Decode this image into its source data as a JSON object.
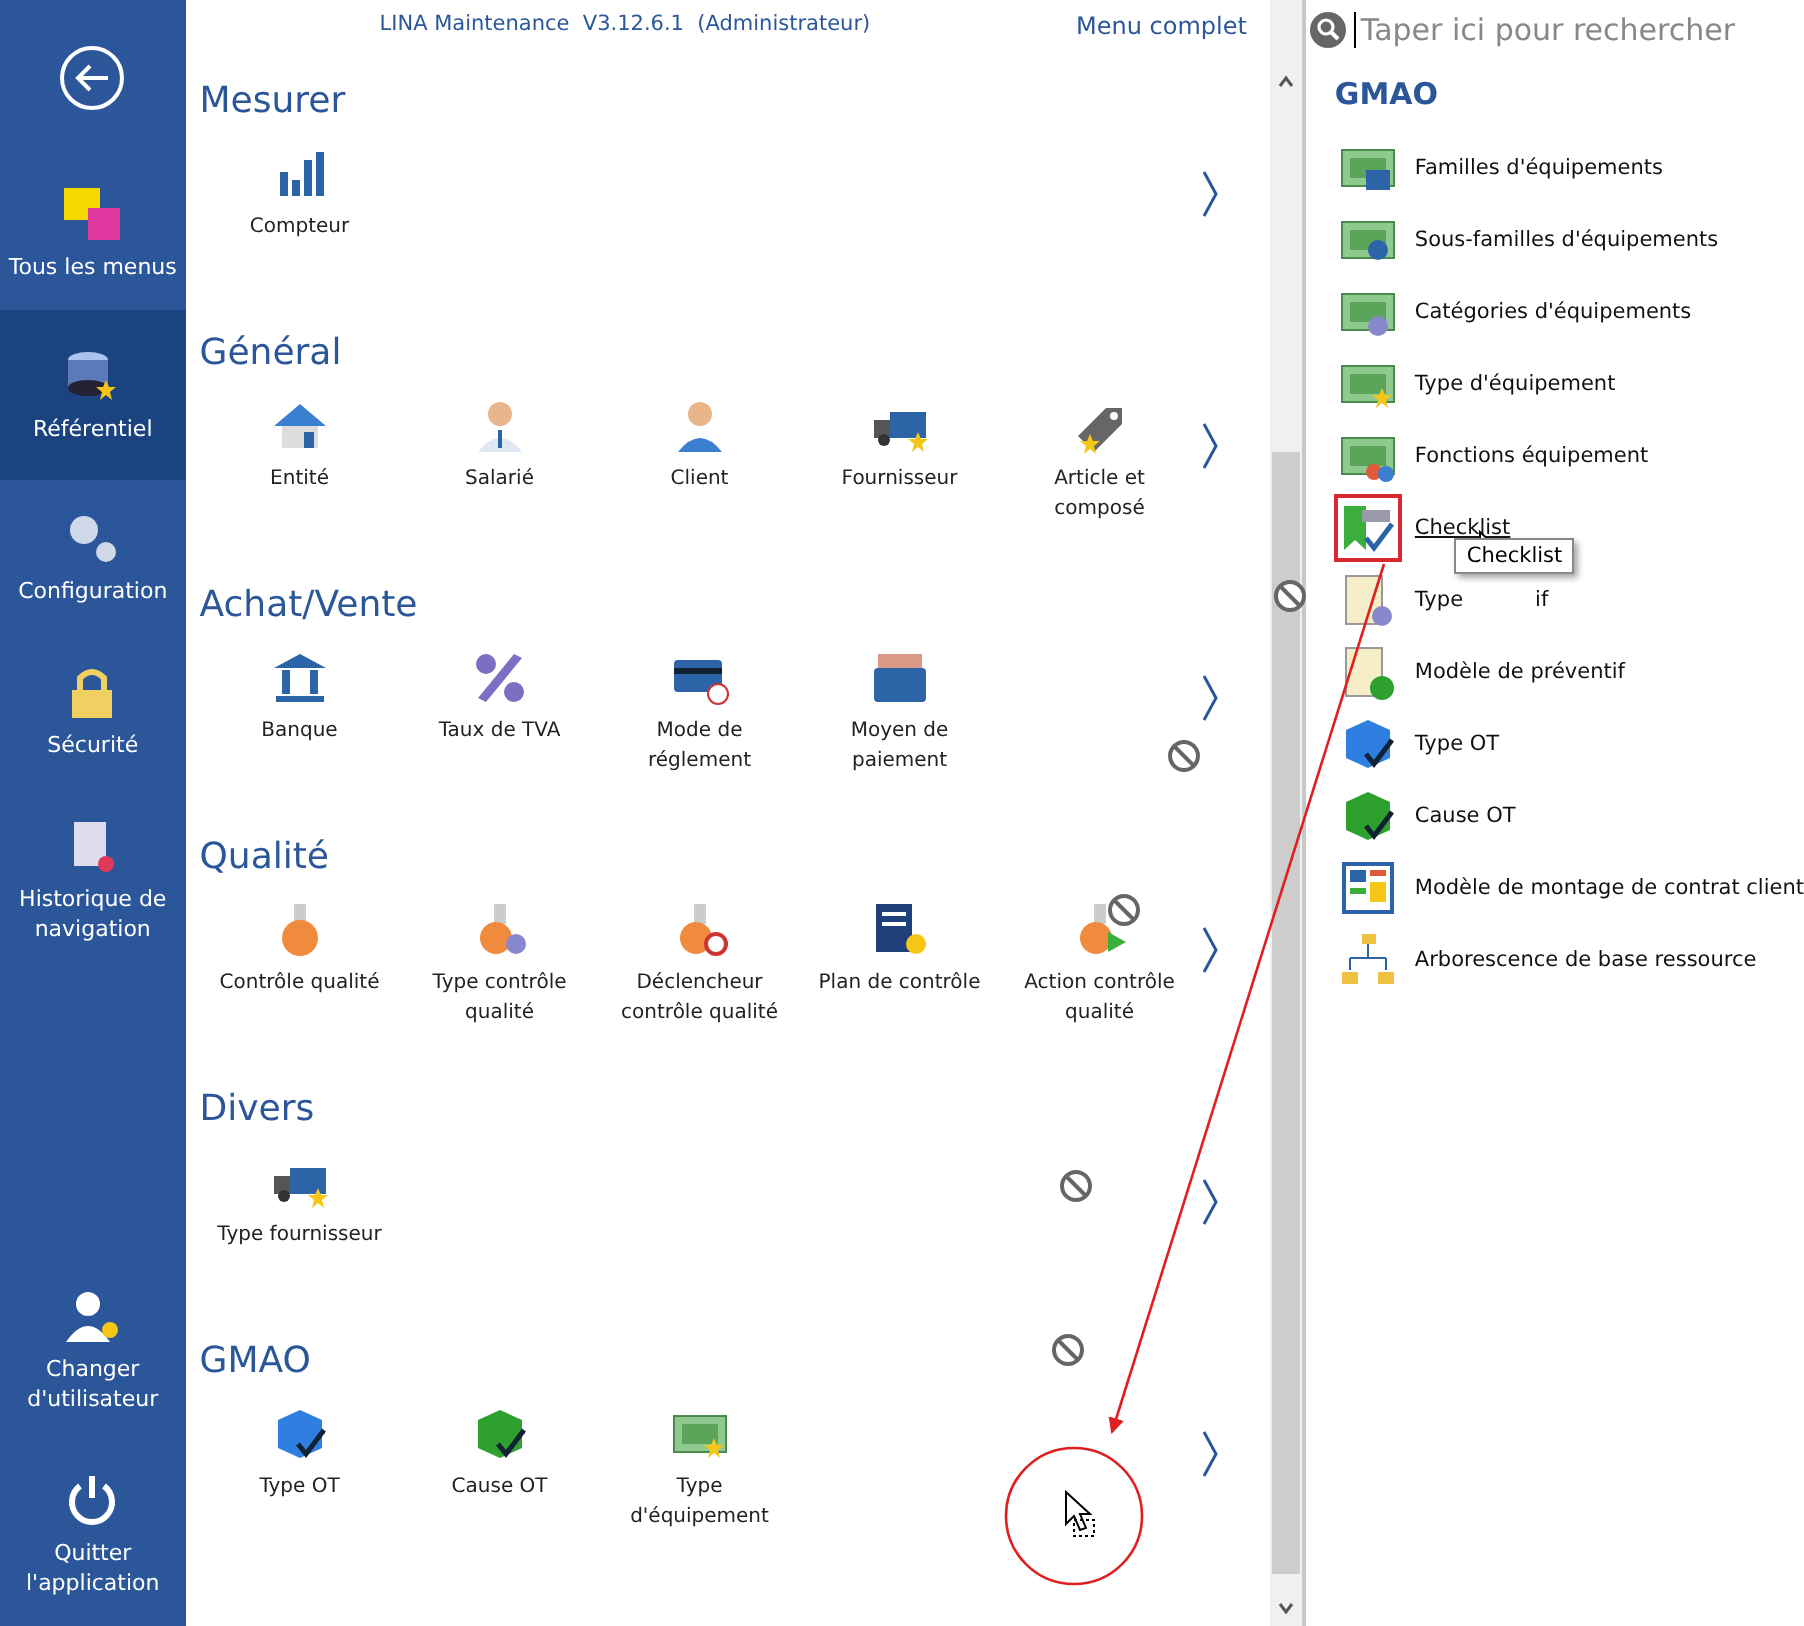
{
  "sidebar": {
    "items": [
      {
        "kind": "back",
        "selected": false
      },
      {
        "kind": "logo",
        "label": "Tous les menus",
        "selected": false
      },
      {
        "kind": "nav",
        "label": "Référentiel",
        "selected": true
      },
      {
        "kind": "nav",
        "label": "Configuration",
        "selected": false
      },
      {
        "kind": "nav",
        "label": "Sécurité",
        "selected": false
      },
      {
        "kind": "nav",
        "label": "Historique de navigation",
        "selected": false
      },
      {
        "kind": "spacer"
      },
      {
        "kind": "nav",
        "label": "Changer d'utilisateur",
        "selected": false
      },
      {
        "kind": "nav",
        "label": "Quitter l'application",
        "selected": false
      }
    ]
  },
  "header": {
    "title": "LINA Maintenance  V3.12.6.1  (Administrateur)",
    "link": "Menu complet"
  },
  "sections": [
    {
      "title": "Mesurer",
      "items": [
        "Compteur"
      ]
    },
    {
      "title": "Général",
      "items": [
        "Entité",
        "Salarié",
        "Client",
        "Fournisseur",
        "Article et composé"
      ]
    },
    {
      "title": "Achat/Vente",
      "items": [
        "Banque",
        "Taux de TVA",
        "Mode de réglement",
        "Moyen de paiement"
      ]
    },
    {
      "title": "Qualité",
      "items": [
        "Contrôle qualité",
        "Type contrôle qualité",
        "Déclencheur contrôle qualité",
        "Plan de contrôle",
        "Action contrôle qualité"
      ]
    },
    {
      "title": "Divers",
      "items": [
        "Type fournisseur"
      ]
    },
    {
      "title": "GMAO",
      "items": [
        "Type OT",
        "Cause OT",
        "Type d'équipement"
      ]
    }
  ],
  "search": {
    "placeholder": "Taper ici pour rechercher"
  },
  "panel": {
    "title": "GMAO",
    "items": [
      {
        "label": "Familles d'équipements",
        "highlighted": false
      },
      {
        "label": "Sous-familles d'équipements",
        "highlighted": false
      },
      {
        "label": "Catégories d'équipements",
        "highlighted": false
      },
      {
        "label": "Type d'équipement",
        "highlighted": false
      },
      {
        "label": "Fonctions équipement",
        "highlighted": false
      },
      {
        "label": "Checklist",
        "highlighted": true
      },
      {
        "label": "Type",
        "label_tail": "if",
        "highlighted": false
      },
      {
        "label": "Modèle de préventif",
        "highlighted": false
      },
      {
        "label": "Type OT",
        "highlighted": false
      },
      {
        "label": "Cause OT",
        "highlighted": false
      },
      {
        "label": "Modèle de montage de contrat client",
        "highlighted": false
      },
      {
        "label": "Arborescence de base ressource",
        "highlighted": false
      }
    ]
  },
  "tooltip": {
    "text": "Checklist"
  }
}
